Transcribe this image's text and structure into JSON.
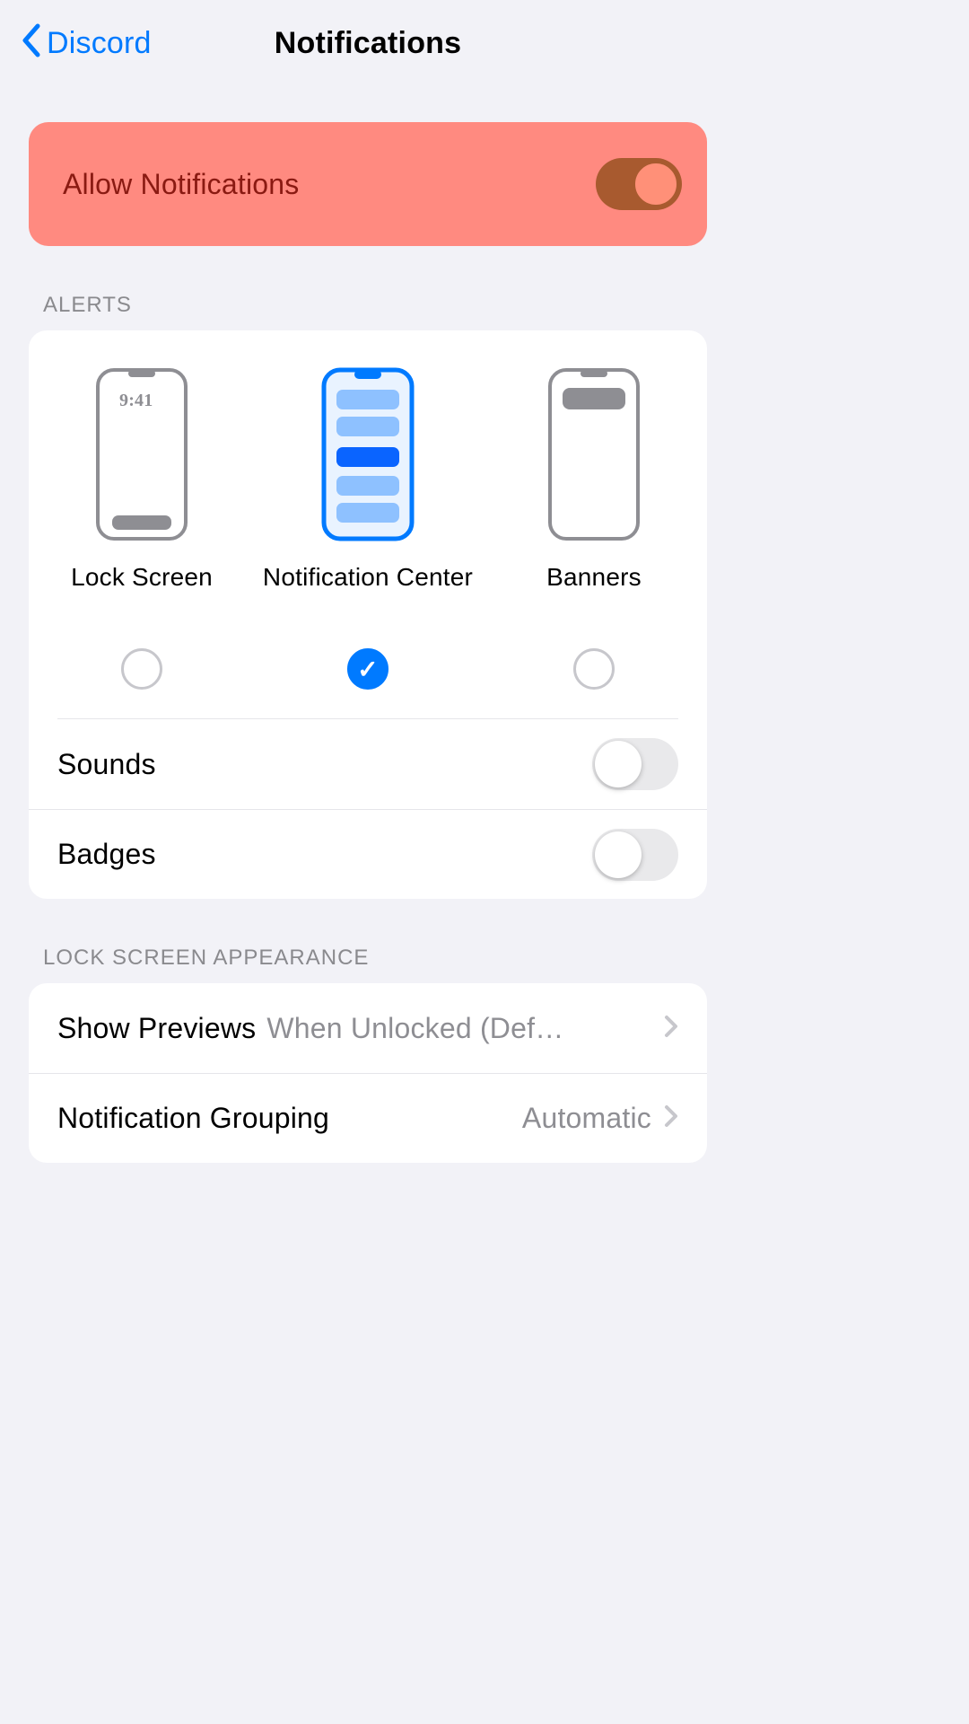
{
  "nav": {
    "back_label": "Discord",
    "title": "Notifications"
  },
  "allow": {
    "label": "Allow Notifications",
    "on": true
  },
  "alerts": {
    "header": "Alerts",
    "lockscreen_time": "9:41",
    "options": [
      {
        "label": "Lock Screen",
        "selected": false
      },
      {
        "label": "Notification Center",
        "selected": true
      },
      {
        "label": "Banners",
        "selected": false
      }
    ],
    "sounds": {
      "label": "Sounds",
      "on": false
    },
    "badges": {
      "label": "Badges",
      "on": false
    }
  },
  "lock_appearance": {
    "header": "Lock Screen Appearance",
    "show_previews": {
      "label": "Show Previews",
      "value": "When Unlocked (Def…"
    },
    "grouping": {
      "label": "Notification Grouping",
      "value": "Automatic"
    }
  }
}
